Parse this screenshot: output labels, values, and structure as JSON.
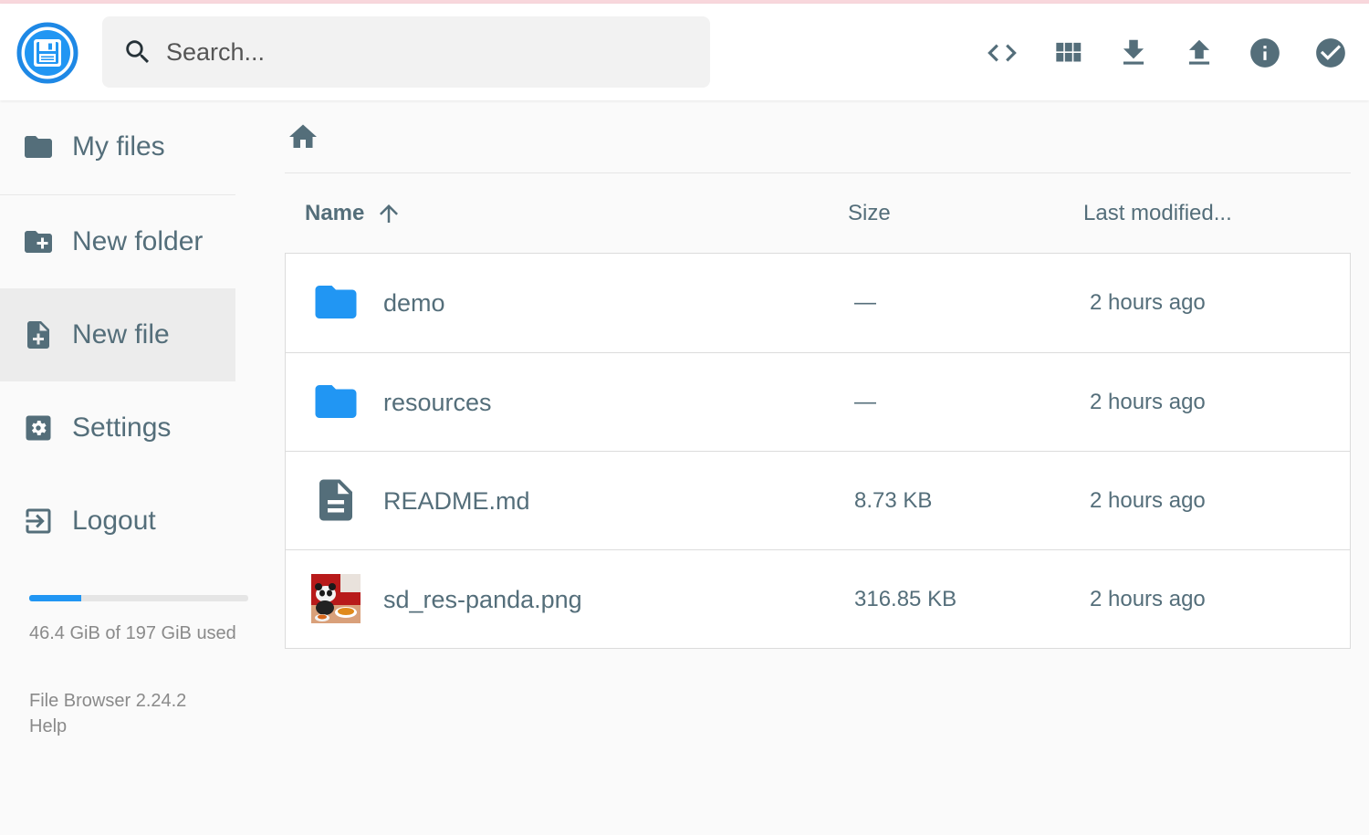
{
  "header": {
    "search_placeholder": "Search...",
    "actions": [
      "code-toggle-icon",
      "grid-view-icon",
      "download-icon",
      "upload-icon",
      "info-icon",
      "check-icon"
    ]
  },
  "sidebar": {
    "items": [
      {
        "label": "My files",
        "icon": "folder-icon"
      },
      {
        "label": "New folder",
        "icon": "new-folder-icon"
      },
      {
        "label": "New file",
        "icon": "new-file-icon",
        "active": true
      },
      {
        "label": "Settings",
        "icon": "settings-icon"
      },
      {
        "label": "Logout",
        "icon": "logout-icon"
      }
    ],
    "usage": {
      "text": "46.4 GiB of 197 GiB used",
      "fraction": 0.236
    },
    "credits": {
      "version": "File Browser 2.24.2",
      "help": "Help"
    }
  },
  "table": {
    "headers": {
      "name": "Name",
      "size": "Size",
      "modified": "Last modified..."
    },
    "rows": [
      {
        "name": "demo",
        "size": "—",
        "modified": "2 hours ago",
        "type": "folder"
      },
      {
        "name": "resources",
        "size": "—",
        "modified": "2 hours ago",
        "type": "folder"
      },
      {
        "name": "README.md",
        "size": "8.73 KB",
        "modified": "2 hours ago",
        "type": "document"
      },
      {
        "name": "sd_res-panda.png",
        "size": "316.85 KB",
        "modified": "2 hours ago",
        "type": "image"
      }
    ]
  },
  "colors": {
    "accent": "#2196f3",
    "text": "#546e7a",
    "folder": "#2196f3"
  }
}
